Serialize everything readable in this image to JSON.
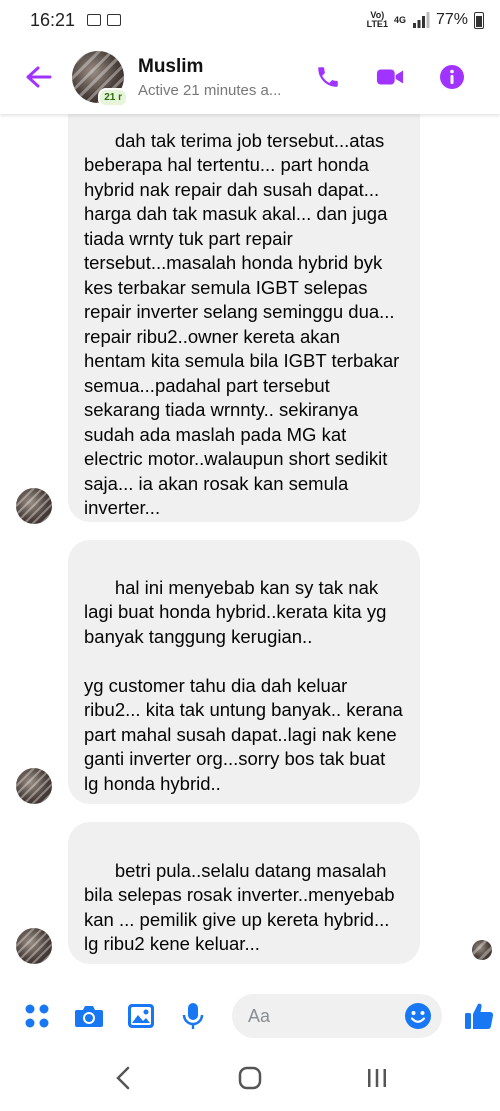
{
  "status_bar": {
    "time": "16:21",
    "network_top": "Vo)",
    "network_bottom": "LTE1",
    "net_type": "4G",
    "battery": "77%"
  },
  "header": {
    "contact_name": "Muslim",
    "active_status": "Active 21 minutes a...",
    "active_badge": "21 r",
    "accent_color": "#a033ff"
  },
  "messages": [
    {
      "text": "dah tak terima job tersebut...atas beberapa hal tertentu... part honda hybrid nak repair dah susah dapat... harga dah tak masuk akal... dan juga tiada wrnty tuk part repair tersebut...masalah honda hybrid byk kes terbakar semula IGBT selepas repair inverter selang seminggu dua... repair ribu2..owner kereta akan hentam kita semula bila IGBT terbakar semua...padahal part tersebut sekarang tiada wrnnty.. sekiranya sudah ada maslah pada MG kat electric motor..walaupun short sedikit saja... ia akan rosak kan semula inverter..."
    },
    {
      "text": "hal ini menyebab kan sy tak nak lagi buat honda hybrid..kerata kita yg banyak tanggung kerugian..\n\nyg customer tahu dia dah keluar ribu2... kita tak untung banyak.. kerana part mahal susah dapat..lagi nak kene ganti inverter org...sorry bos tak buat lg honda hybrid.."
    },
    {
      "text": "betri pula..selalu datang masalah bila selepas rosak inverter..menyebab kan ... pemilik give up kereta hybrid... lg ribu2 kene keluar..."
    }
  ],
  "composer": {
    "placeholder": "Aa"
  },
  "icons": {
    "back": "back-arrow-icon",
    "call": "phone-icon",
    "video": "video-camera-icon",
    "info": "info-icon",
    "menu": "four-dots-icon",
    "camera": "camera-icon",
    "gallery": "image-icon",
    "mic": "microphone-icon",
    "emoji": "smiley-icon",
    "like": "thumbs-up-icon"
  }
}
